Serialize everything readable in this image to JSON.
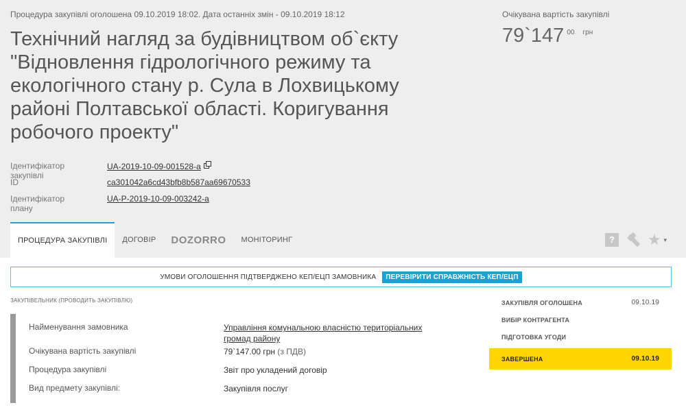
{
  "header": {
    "meta_line": "Процедура закупівлі оголошена 09.10.2019 18:02. Дата останніх змін - 09.10.2019 18:12",
    "title": "Технічний нагляд за будівництвом об`єкту \"Відновлення гідрологічного режиму та екологічного стану р. Сула в Лохвицькому районі Полтавської області. Коригування робочого проекту\"",
    "price_label": "Очікувана вартість закупівлі",
    "price_main": "79`147",
    "price_cents": "00",
    "price_currency": "грн"
  },
  "identifiers": [
    {
      "label": "Ідентифікатор закупівлі",
      "value": "UA-2019-10-09-001528-a",
      "copy_icon": "copy-icon"
    },
    {
      "label": "ID",
      "value": "ca301042a6cd43bfb8b587aa69670533"
    },
    {
      "label": "Ідентифікатор плану",
      "value": "UA-P-2019-10-09-003242-a"
    }
  ],
  "tabs": [
    {
      "label": "ПРОЦЕДУРА ЗАКУПІВЛІ",
      "active": true
    },
    {
      "label": "ДОГОВІР"
    },
    {
      "label": "DOZORRO"
    },
    {
      "label": "МОНІТОРИНГ"
    }
  ],
  "toolbar": {
    "help_label": "?",
    "icons": [
      "question-icon",
      "gavel-icon",
      "star-icon",
      "caret-down-icon"
    ]
  },
  "signed_bar": {
    "text": "УМОВИ ОГОЛОШЕННЯ ПІДТВЕРДЖЕНО КЕП/ЕЦП ЗАМОВНИКА",
    "button": "ПЕРЕВІРИТИ СПРАВЖНІСТЬ КЕП/ЕЦП"
  },
  "section_label": "ЗАКУПІВЕЛЬНИК (ПРОВОДИТЬ ЗАКУПІВЛЮ)",
  "info": [
    {
      "key": "Найменування замовника",
      "value": "Управління комунальною власністю територіальних громад району"
    },
    {
      "key": "Очікувана вартість закупівлі",
      "value": "79`147.00 грн",
      "note": "(з ПДВ)"
    },
    {
      "key": "Процедура закупівлі",
      "value": "Звіт про укладений договір"
    },
    {
      "key": "Вид предмету закупівлі:",
      "value": "Закупівля послуг"
    }
  ],
  "statuses": [
    {
      "label": "ЗАКУПІВЛЯ ОГОЛОШЕНА",
      "date": "09.10.19"
    },
    {
      "label": "ВИБІР КОНТРАГЕНТА",
      "date": ""
    },
    {
      "label": "ПІДГОТОВКА УГОДИ",
      "date": ""
    },
    {
      "label": "ЗАВЕРШЕНА",
      "date": "09.10.19",
      "current": true
    }
  ],
  "colors": {
    "accent": "#1ea0d3",
    "status_current": "#ffd600",
    "header_bg": "#eeeeee"
  }
}
